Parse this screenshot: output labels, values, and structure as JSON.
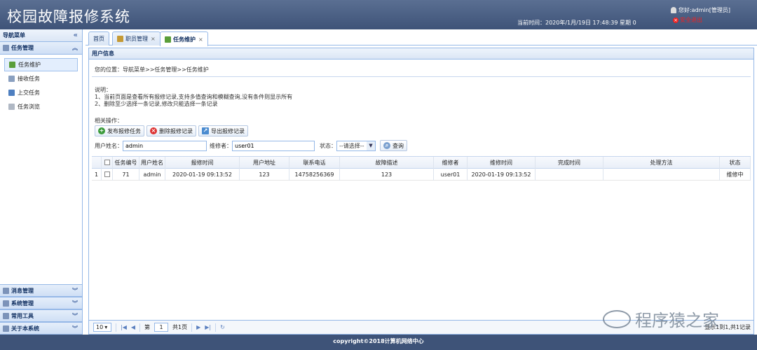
{
  "header": {
    "app_title": "校园故障报修系统",
    "user_greeting": "您好:admin[管理员]",
    "logout_label": "安全退出",
    "datetime": "当前时间：2020年/1月/19日    17:48:39    星期 0"
  },
  "sidebar": {
    "nav_title": "导航菜单",
    "active_group": "任务管理",
    "items": [
      {
        "label": "任务维护",
        "active": true,
        "icon": "maintenance-icon"
      },
      {
        "label": "接收任务",
        "active": false,
        "icon": "list-icon"
      },
      {
        "label": "上交任务",
        "active": false,
        "icon": "submit-icon"
      },
      {
        "label": "任务浏览",
        "active": false,
        "icon": "browse-icon"
      }
    ],
    "bottom_groups": [
      "消息管理",
      "系统管理",
      "常用工具",
      "关于本系统"
    ]
  },
  "tabs": [
    {
      "label": "首页",
      "closable": false
    },
    {
      "label": "职员管理",
      "closable": true
    },
    {
      "label": "任务维护",
      "closable": true,
      "active": true
    }
  ],
  "panel": {
    "title": "用户信息",
    "breadcrumb": "您的位置：导航菜单>>任务管理>>任务维护",
    "desc_title": "说明：",
    "desc_line1": "1、当前页面是查看所有报修记录,支持多值查询和模糊查询,没有条件则显示所有",
    "desc_line2": "2、删除至少选择一条记录,修改只能选择一条记录",
    "ops_label": "相关操作：",
    "buttons": {
      "publish": "发布报修任务",
      "delete": "删除报修记录",
      "export": "导出报修记录"
    },
    "search": {
      "username_label": "用户姓名：",
      "username_value": "admin",
      "repairer_label": "维修者：",
      "repairer_value": "user01",
      "status_label": "状态：",
      "status_value": "--请选择--",
      "search_btn": "查询"
    }
  },
  "grid": {
    "columns": [
      "任务编号",
      "用户姓名",
      "报修时间",
      "用户地址",
      "联系电话",
      "故障描述",
      "维修者",
      "维修时间",
      "完成时间",
      "处理方法",
      "状态"
    ],
    "rows": [
      {
        "rownum": "1",
        "cells": [
          "71",
          "admin",
          "2020-01-19 09:13:52",
          "123",
          "14758256369",
          "123",
          "user01",
          "2020-01-19 09:13:52",
          "",
          "",
          "维修中"
        ]
      }
    ]
  },
  "pager": {
    "page_size": "10",
    "page_label": "第",
    "page_value": "1",
    "page_total": "共1页",
    "info": "显示1到1,共1记录"
  },
  "footer": {
    "copyright": "copyright©2018计算机网络中心"
  },
  "watermark": {
    "text": "程序猿之家"
  }
}
